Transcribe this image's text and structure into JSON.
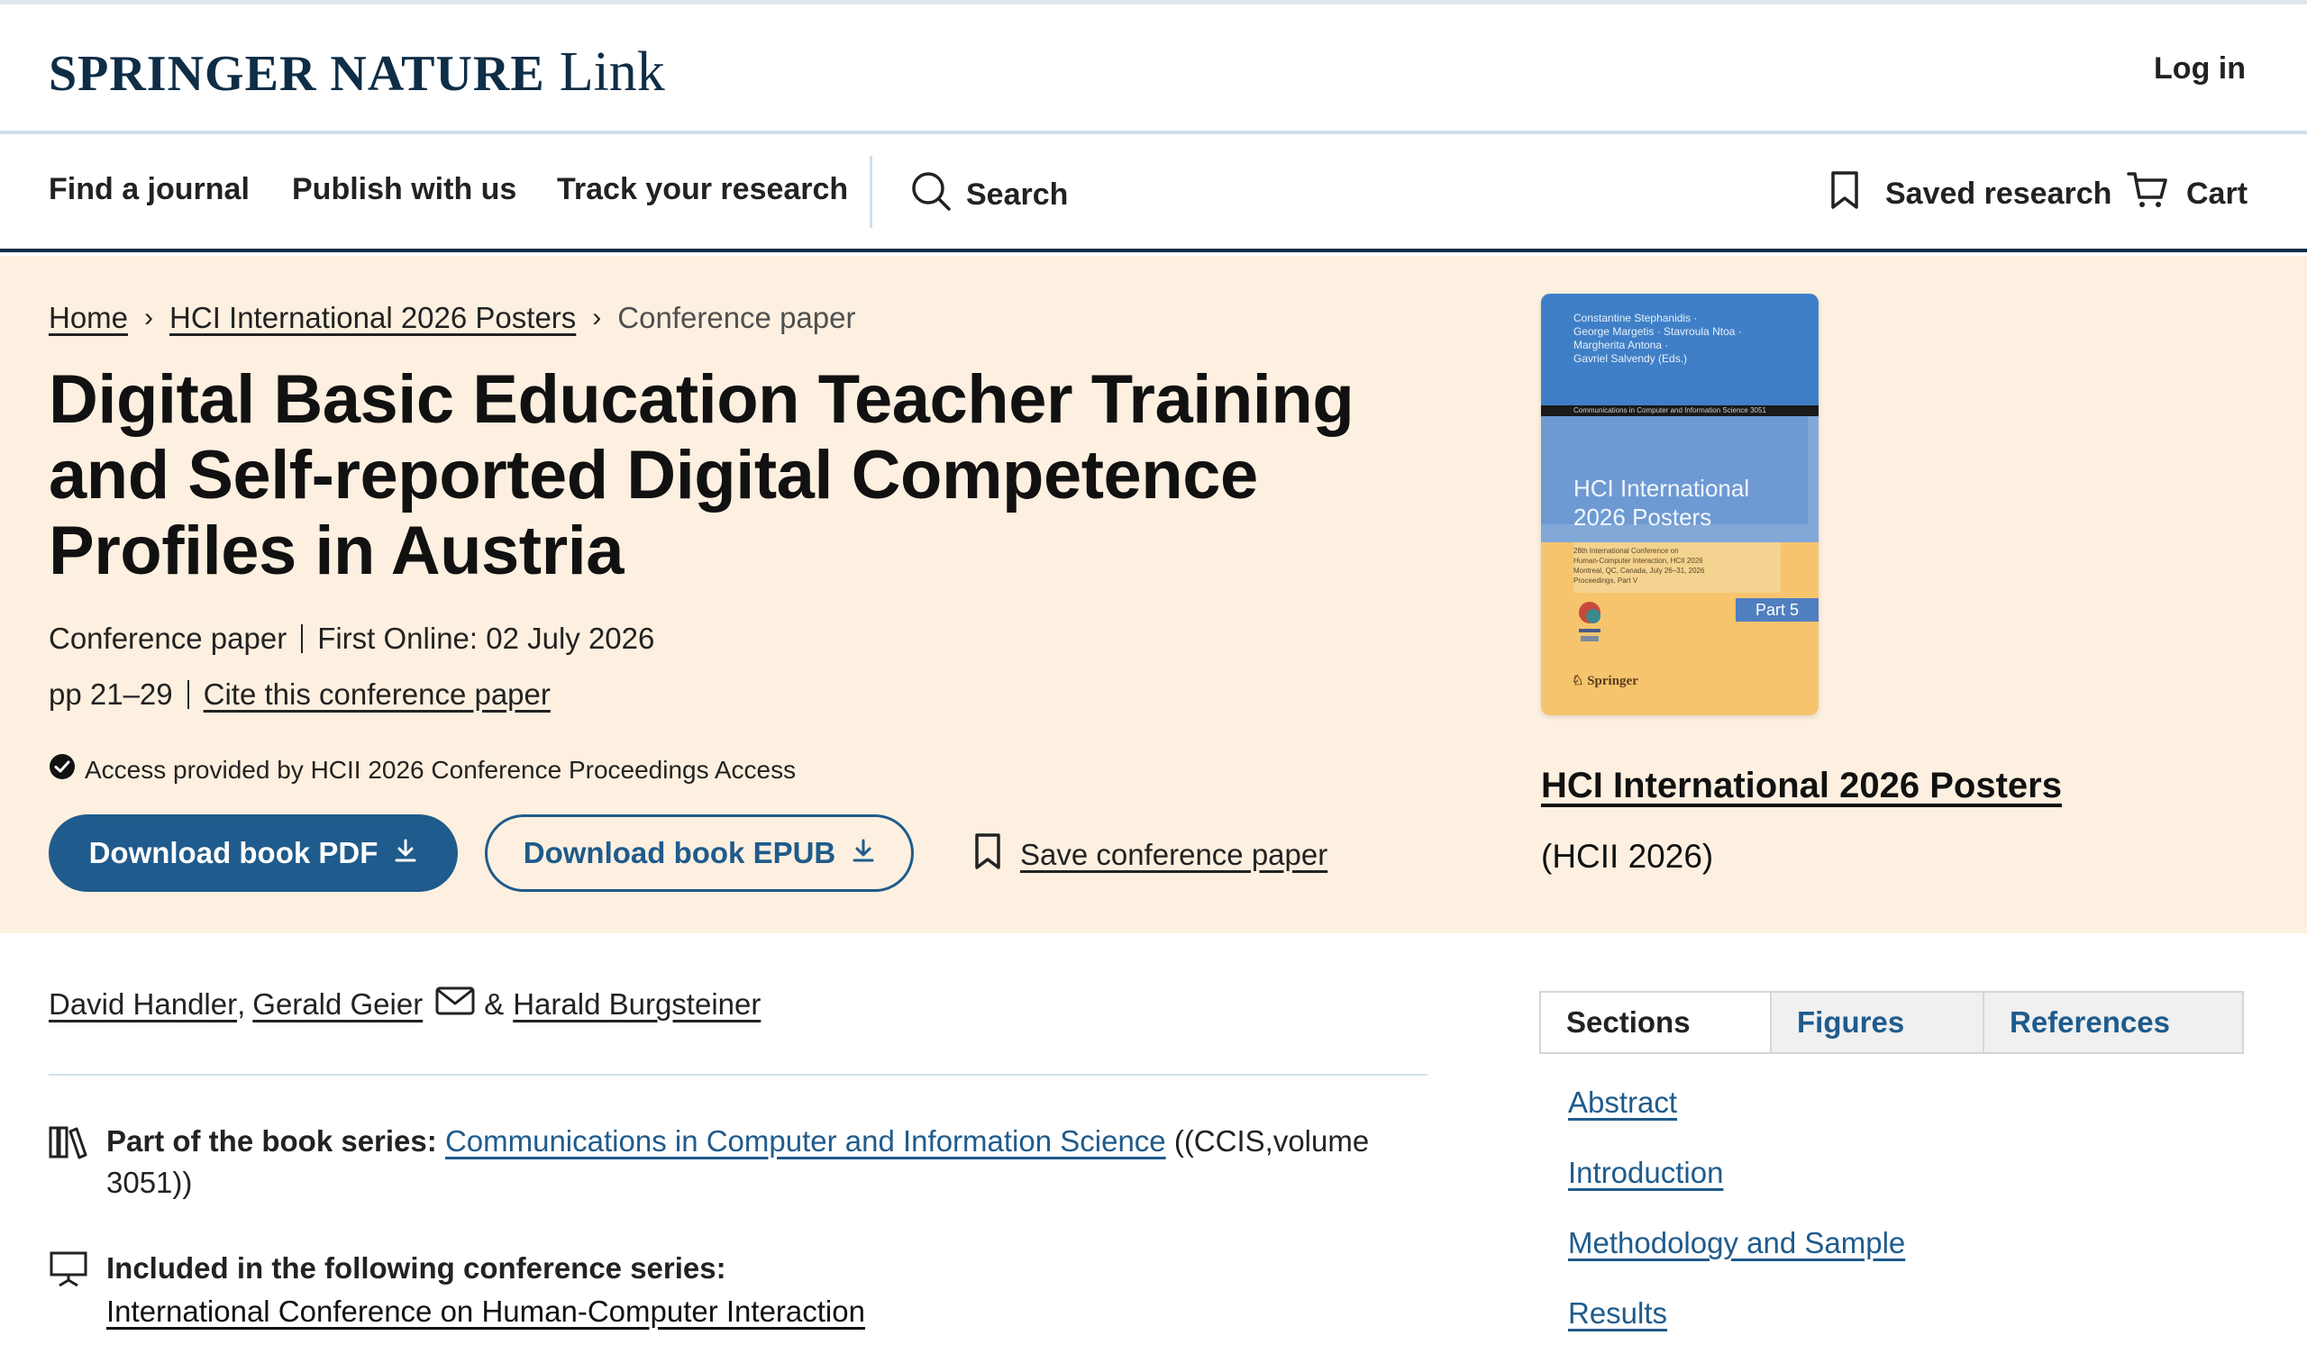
{
  "header": {
    "brand": "SPRINGER NATURE",
    "brand_suffix": "Link",
    "login": "Log in"
  },
  "nav": {
    "find_journal": "Find a journal",
    "publish": "Publish with us",
    "track": "Track your research",
    "search": "Search",
    "saved": "Saved research",
    "cart": "Cart"
  },
  "breadcrumb": {
    "home": "Home",
    "book": "HCI International 2026 Posters",
    "current": "Conference paper"
  },
  "article": {
    "title": "Digital Basic Education Teacher Training and Self-reported Digital Competence Profiles in Austria",
    "type": "Conference paper",
    "first_online": "First Online: 02 July 2026",
    "pages": "pp 21–29",
    "cite": "Cite this conference paper",
    "access": "Access provided by HCII 2026 Conference Proceedings Access",
    "download_pdf": "Download book PDF",
    "download_epub": "Download book EPUB",
    "save": "Save conference paper"
  },
  "book": {
    "title": "HCI International 2026 Posters",
    "abbr": "(HCII 2026)",
    "cover_authors": [
      "Constantine Stephanidis ·",
      "George Margetis · Stavroula Ntoa ·",
      "Margherita Antona ·",
      "Gavriel Salvendy (Eds.)"
    ],
    "cover_series": "Communications in Computer and Information Science 3051",
    "cover_title_line1": "HCI International",
    "cover_title_line2": "2026 Posters",
    "cover_sub": [
      "28th International Conference on",
      "Human-Computer Interaction, HCII 2026",
      "Montreal, QC, Canada, July 26–31, 2026",
      "Proceedings, Part V"
    ],
    "cover_part": "Part 5",
    "cover_publisher": "Springer"
  },
  "authors": {
    "a1": "David Handler",
    "sep1": ",",
    "a2": "Gerald Geier",
    "amp": "&",
    "a3": "Harald Burgsteiner"
  },
  "series": {
    "book_series_label": "Part of the book series:",
    "book_series_name": "Communications in Computer and Information Science",
    "book_series_suffix": "((CCIS,volume 3051))",
    "conf_series_label": "Included in the following conference series:",
    "conf_series_name": "International Conference on Human-Computer Interaction"
  },
  "tabs": {
    "sections": "Sections",
    "figures": "Figures",
    "references": "References"
  },
  "toc": [
    "Abstract",
    "Introduction",
    "Methodology and Sample",
    "Results"
  ],
  "colors": {
    "brand_navy": "#0e2d46",
    "accent_blue": "#1f5b8c",
    "hero_bg": "#fdf0e0"
  }
}
